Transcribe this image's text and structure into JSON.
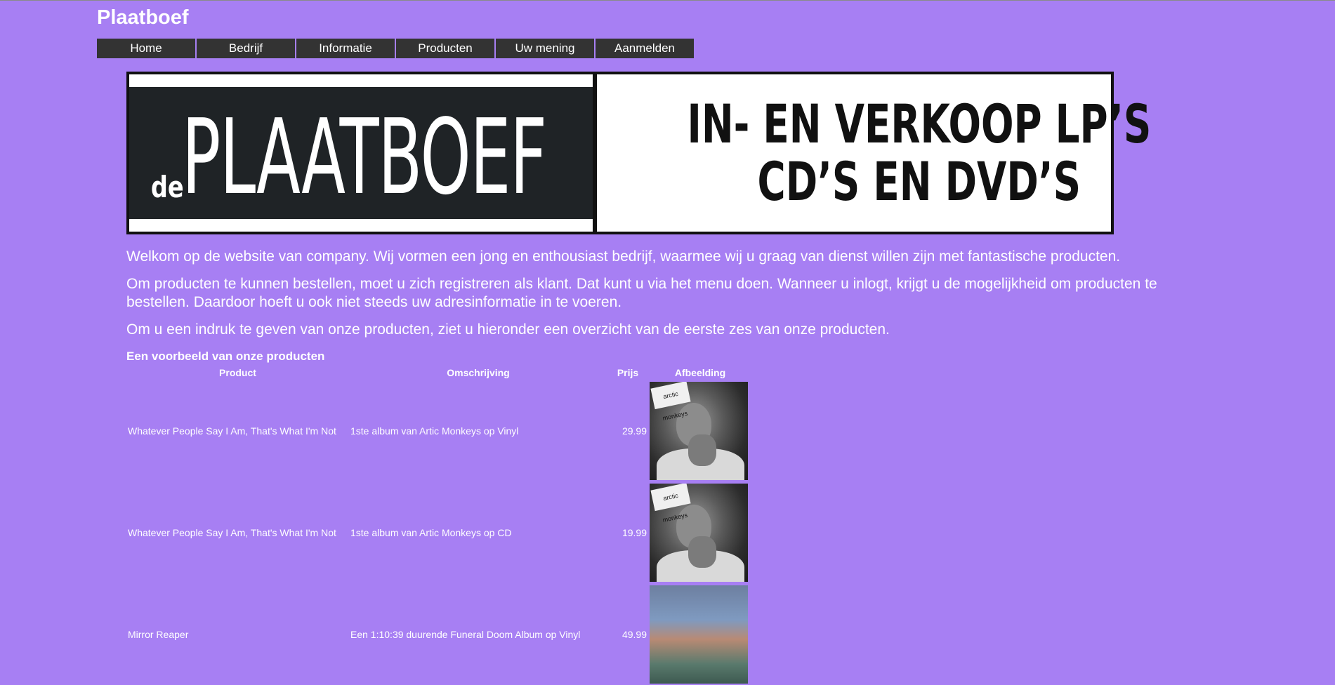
{
  "site": {
    "title": "Plaatboef"
  },
  "nav": {
    "items": [
      "Home",
      "Bedrijf",
      "Informatie",
      "Producten",
      "Uw mening",
      "Aanmelden"
    ]
  },
  "banner": {
    "logo_small": "de",
    "logo_main": "PLAATBOEF",
    "tagline_line1": "IN- EN VERKOOP LP’S",
    "tagline_line2": "CD’S EN DVD’S"
  },
  "intro": {
    "p1": "Welkom op de website van company. Wij vormen een jong en enthousiast bedrijf, waarmee wij u graag van dienst willen zijn met fantastische producten.",
    "p2": "Om producten te kunnen bestellen, moet u zich registreren als klant. Dat kunt u via het menu doen. Wanneer u inlogt, krijgt u de mogelijkheid om producten te bestellen. Daardoor hoeft u ook niet steeds uw adresinformatie in te voeren.",
    "p3": "Om u een indruk te geven van onze producten, ziet u hieronder een overzicht van de eerste zes van onze producten."
  },
  "products": {
    "heading": "Een voorbeeld van onze producten",
    "columns": [
      "Product",
      "Omschrijving",
      "Prijs",
      "Afbeelding"
    ],
    "rows": [
      {
        "product": "Whatever People Say I Am, That's What I'm Not",
        "description": "1ste album van Artic Monkeys op Vinyl",
        "price": "29.99",
        "cover_label": "arctic monkeys"
      },
      {
        "product": "Whatever People Say I Am, That's What I'm Not",
        "description": "1ste album van Artic Monkeys op CD",
        "price": "19.99",
        "cover_label": "arctic monkeys"
      },
      {
        "product": "Mirror Reaper",
        "description": "Een 1:10:39 duurende Funeral Doom Album op Vinyl",
        "price": "49.99"
      }
    ]
  }
}
